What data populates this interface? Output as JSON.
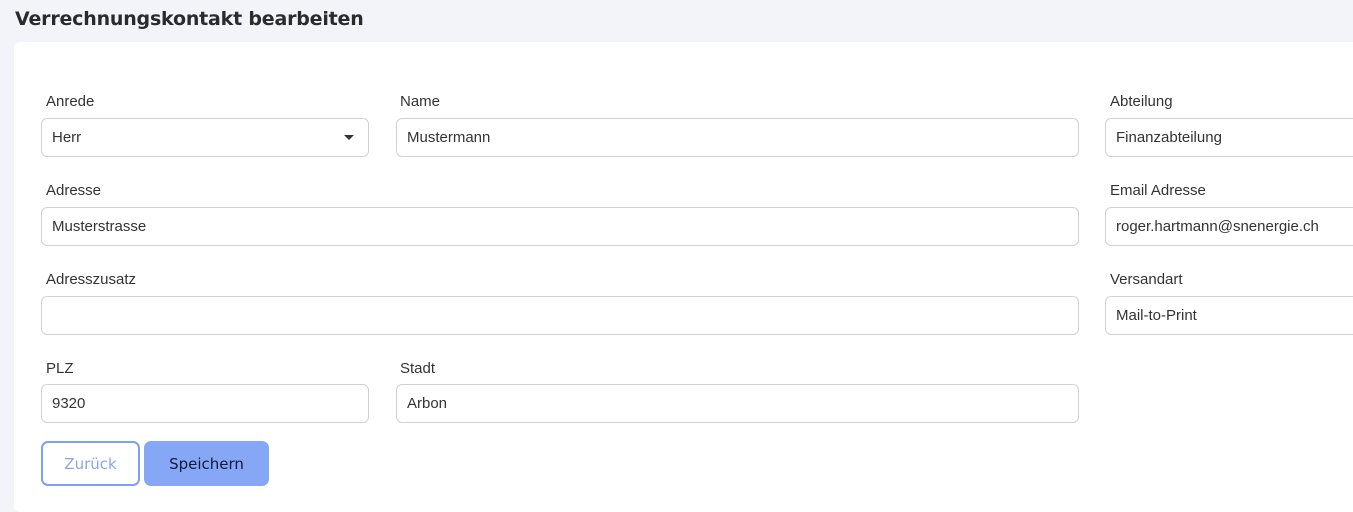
{
  "header": {
    "title": "Verrechnungskontakt bearbeiten"
  },
  "form": {
    "anrede": {
      "label": "Anrede",
      "value": "Herr"
    },
    "name": {
      "label": "Name",
      "value": "Mustermann"
    },
    "abteilung": {
      "label": "Abteilung",
      "value": "Finanzabteilung"
    },
    "adresse": {
      "label": "Adresse",
      "value": "Musterstrasse"
    },
    "email": {
      "label": "Email Adresse",
      "value": "roger.hartmann@snenergie.ch"
    },
    "adresszusatz": {
      "label": "Adresszusatz",
      "value": ""
    },
    "versandart": {
      "label": "Versandart",
      "value": "Mail-to-Print"
    },
    "plz": {
      "label": "PLZ",
      "value": "9320"
    },
    "stadt": {
      "label": "Stadt",
      "value": "Arbon"
    }
  },
  "actions": {
    "back_label": "Zurück",
    "save_label": "Speichern"
  }
}
